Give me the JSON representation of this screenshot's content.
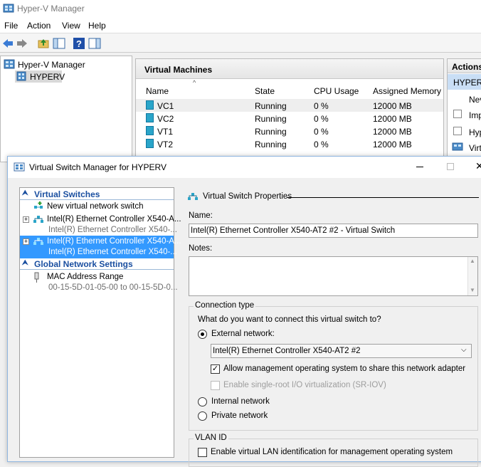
{
  "hyperv": {
    "title": "Hyper-V Manager",
    "menu": [
      "File",
      "Action",
      "View",
      "Help"
    ],
    "tree": {
      "root": "Hyper-V Manager",
      "server": "HYPERV"
    },
    "vm_pane": {
      "title": "Virtual Machines",
      "columns": [
        "Name",
        "State",
        "CPU Usage",
        "Assigned Memory"
      ],
      "rows": [
        {
          "name": "VC1",
          "state": "Running",
          "cpu": "0 %",
          "mem": "12000 MB"
        },
        {
          "name": "VC2",
          "state": "Running",
          "cpu": "0 %",
          "mem": "12000 MB"
        },
        {
          "name": "VT1",
          "state": "Running",
          "cpu": "0 %",
          "mem": "12000 MB"
        },
        {
          "name": "VT2",
          "state": "Running",
          "cpu": "0 %",
          "mem": "12000 MB"
        }
      ]
    },
    "actions_pane": {
      "title": "Actions",
      "items": [
        "HYPERV",
        "Nev",
        "Imp",
        "Hyp",
        "Virt"
      ]
    }
  },
  "vsm": {
    "title": "Virtual Switch Manager for HYPERV",
    "left": {
      "virtual_switches_header": "Virtual Switches",
      "new_switch": "New virtual network switch",
      "switch1_name": "Intel(R) Ethernet Controller X540-A...",
      "switch1_sub": "Intel(R) Ethernet Controller X540-...",
      "switch2_name": "Intel(R) Ethernet Controller X540-A...",
      "switch2_sub": "Intel(R) Ethernet Controller X540-...",
      "global_header": "Global Network Settings",
      "mac_label": "MAC Address Range",
      "mac_value": "00-15-5D-01-05-00 to 00-15-5D-0..."
    },
    "right": {
      "props_title": "Virtual Switch Properties",
      "name_label": "Name:",
      "name_value": "Intel(R) Ethernet Controller X540-AT2 #2 - Virtual Switch",
      "notes_label": "Notes:",
      "conn_group": "Connection type",
      "conn_question": "What do you want to connect this virtual switch to?",
      "external_label": "External network:",
      "adapter_selected": "Intel(R) Ethernet Controller X540-AT2 #2",
      "allow_mgmt": "Allow management operating system to share this network adapter",
      "sriov": "Enable single-root I/O virtualization (SR-IOV)",
      "internal_label": "Internal network",
      "private_label": "Private network",
      "vlan_group": "VLAN ID",
      "vlan_enable": "Enable virtual LAN identification for management operating system"
    }
  },
  "colors": {
    "selection": "#3399ff",
    "section_header": "#1a4fa0"
  }
}
